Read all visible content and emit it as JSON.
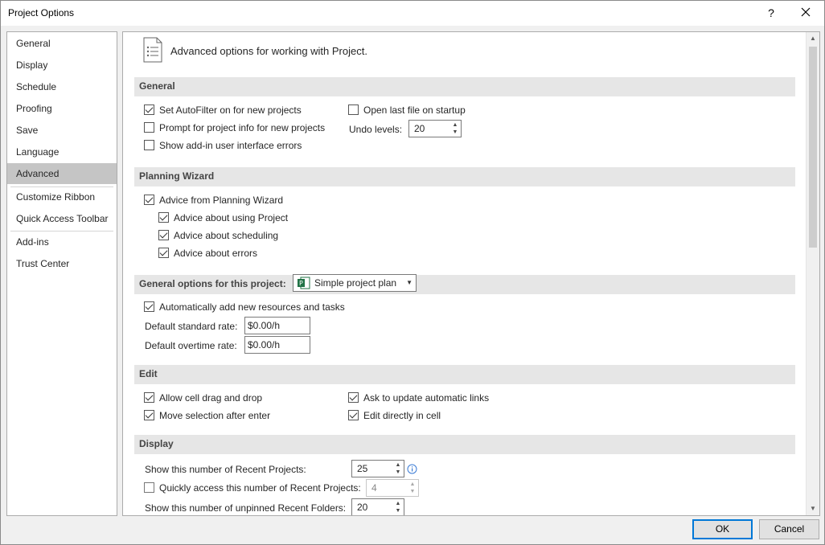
{
  "window": {
    "title": "Project Options",
    "help_glyph": "?",
    "close_icon": "close-icon"
  },
  "nav": {
    "items": [
      {
        "label": "General"
      },
      {
        "label": "Display"
      },
      {
        "label": "Schedule"
      },
      {
        "label": "Proofing"
      },
      {
        "label": "Save"
      },
      {
        "label": "Language"
      },
      {
        "label": "Advanced",
        "selected": true
      },
      {
        "label": "Customize Ribbon"
      },
      {
        "label": "Quick Access Toolbar"
      },
      {
        "label": "Add-ins"
      },
      {
        "label": "Trust Center"
      }
    ]
  },
  "header": {
    "text": "Advanced options for working with Project.",
    "icon": "document-list-icon"
  },
  "general": {
    "title": "General",
    "autofilter": {
      "label": "Set AutoFilter on for new projects",
      "checked": true
    },
    "prompt_info": {
      "label": "Prompt for project info for new projects",
      "checked": false
    },
    "addin_errors": {
      "label": "Show add-in user interface errors",
      "checked": false
    },
    "open_last": {
      "label": "Open last file on startup",
      "checked": false
    },
    "undo_label": "Undo levels:",
    "undo_value": "20"
  },
  "planning_wizard": {
    "title": "Planning Wizard",
    "advice": {
      "label": "Advice from Planning Wizard",
      "checked": true
    },
    "advice_using": {
      "label": "Advice about using Project",
      "checked": true
    },
    "advice_scheduling": {
      "label": "Advice about scheduling",
      "checked": true
    },
    "advice_errors": {
      "label": "Advice about errors",
      "checked": true
    }
  },
  "project_options": {
    "title": "General options for this project:",
    "project_select": "Simple project plan",
    "auto_add": {
      "label": "Automatically add new resources and tasks",
      "checked": true
    },
    "std_rate_label": "Default standard rate:",
    "std_rate_value": "$0.00/h",
    "ot_rate_label": "Default overtime rate:",
    "ot_rate_value": "$0.00/h"
  },
  "edit": {
    "title": "Edit",
    "drag_drop": {
      "label": "Allow cell drag and drop",
      "checked": true
    },
    "move_selection": {
      "label": "Move selection after enter",
      "checked": true
    },
    "ask_update": {
      "label": "Ask to update automatic links",
      "checked": true
    },
    "edit_in_cell": {
      "label": "Edit directly in cell",
      "checked": true
    }
  },
  "display": {
    "title": "Display",
    "recent_projects_label": "Show this number of Recent Projects:",
    "recent_projects_value": "25",
    "quick_access": {
      "label": "Quickly access this number of Recent Projects:",
      "checked": false
    },
    "quick_access_value": "4",
    "recent_folders_label": "Show this number of unpinned Recent Folders:",
    "recent_folders_value": "20"
  },
  "buttons": {
    "ok": "OK",
    "cancel": "Cancel"
  },
  "colors": {
    "selected_nav": "#c5c5c5",
    "section_header": "#e6e6e6",
    "excel_green": "#217346"
  }
}
